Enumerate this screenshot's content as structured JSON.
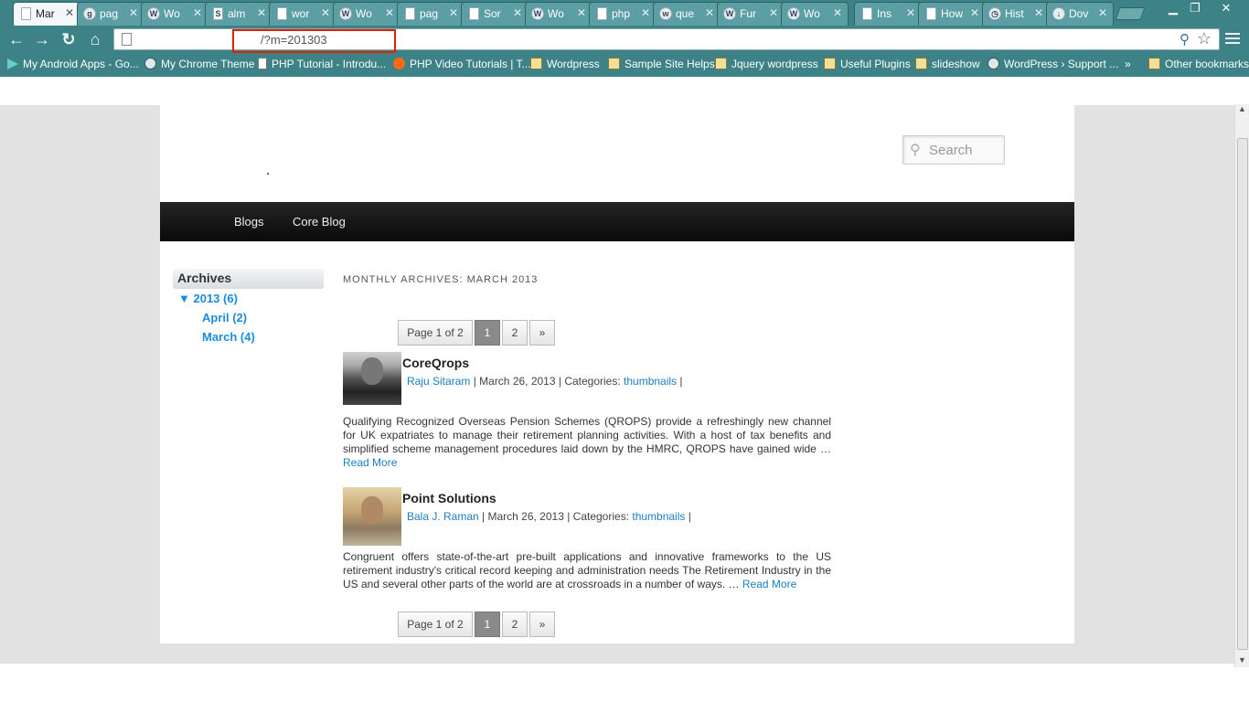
{
  "tabs": [
    {
      "label": "Mar",
      "icon": "page-icon",
      "active": true
    },
    {
      "label": "pag",
      "icon": "google-icon"
    },
    {
      "label": "Wo",
      "icon": "wordpress-icon"
    },
    {
      "label": "alm",
      "icon": "s-icon"
    },
    {
      "label": "wor",
      "icon": "page-icon"
    },
    {
      "label": "Wo",
      "icon": "wordpress-icon"
    },
    {
      "label": "pag",
      "icon": "page-icon"
    },
    {
      "label": "Sor",
      "icon": "page-icon"
    },
    {
      "label": "Wo",
      "icon": "wordpress-icon"
    },
    {
      "label": "php",
      "icon": "page-icon"
    },
    {
      "label": "que",
      "icon": "w-icon"
    },
    {
      "label": "Fur",
      "icon": "wordpress-icon"
    },
    {
      "label": "Wo",
      "icon": "wordpress-icon"
    },
    {
      "label": "Ins",
      "icon": "page-icon"
    },
    {
      "label": "How",
      "icon": "page-icon"
    },
    {
      "label": "Hist",
      "icon": "history-icon"
    },
    {
      "label": "Dov",
      "icon": "download-icon"
    }
  ],
  "address": {
    "url": "/?m=201303"
  },
  "bookmarks": [
    {
      "label": "My Android Apps - Go...",
      "icon": "play-icon"
    },
    {
      "label": "My Chrome Theme",
      "icon": "round-icon"
    },
    {
      "label": "PHP Tutorial - Introdu...",
      "icon": "page-icon"
    },
    {
      "label": "PHP Video Tutorials | T...",
      "icon": "orange-icon"
    },
    {
      "label": "Wordpress",
      "icon": "folder-icon"
    },
    {
      "label": "Sample Site Helps",
      "icon": "folder-icon"
    },
    {
      "label": "Jquery wordpress",
      "icon": "folder-icon"
    },
    {
      "label": "Useful Plugins",
      "icon": "folder-icon"
    },
    {
      "label": "slideshow",
      "icon": "folder-icon"
    },
    {
      "label": "WordPress › Support ...",
      "icon": "wordpress-icon"
    }
  ],
  "bookmarks_more": "»",
  "other_bookmarks": "Other bookmarks",
  "site": {
    "search_placeholder": "Search",
    "nav": [
      "Blogs",
      "Core Blog"
    ],
    "sidebar": {
      "title": "Archives",
      "year": "▼ 2013 (6)",
      "months": [
        "April (2)",
        "March (4)"
      ]
    },
    "archive_title": "MONTHLY ARCHIVES: MARCH 2013",
    "pager": {
      "label": "Page 1 of 2",
      "pages": [
        "1",
        "2"
      ],
      "next": "»"
    },
    "posts": [
      {
        "title": "CoreQrops",
        "author": "Raju Sitaram",
        "date": " | March 26, 2013 | Categories: ",
        "category": "thumbnails",
        "trail": " |",
        "excerpt": "Qualifying Recognized Overseas Pension Schemes (QROPS) provide a refreshingly new channel for UK expatriates to manage their retirement planning activities. With a host of tax benefits and simplified scheme management procedures laid down by the HMRC, QROPS have gained wide … ",
        "read_more": "Read More"
      },
      {
        "title": "Point Solutions",
        "author": "Bala J. Raman",
        "date": " | March 26, 2013 | Categories: ",
        "category": "thumbnails",
        "trail": " |",
        "excerpt": "Congruent offers state-of-the-art pre-built applications and innovative frameworks to the US retirement industry's critical record keeping and administration needs The Retirement Industry in the US and several other parts of the world are at crossroads in a number of ways. … ",
        "read_more": "Read More"
      }
    ]
  }
}
